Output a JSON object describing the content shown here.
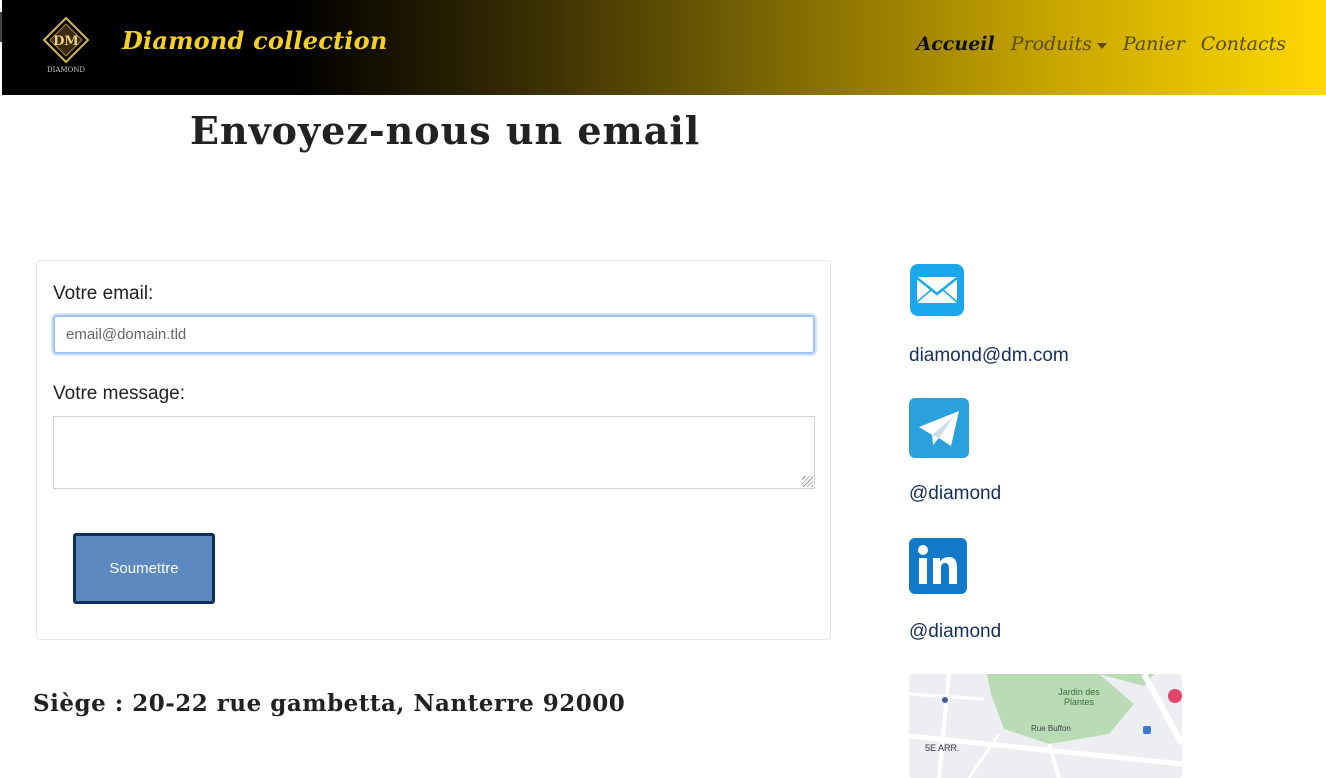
{
  "nav": {
    "brand": "Diamond collection",
    "logo_text": "DIAMOND",
    "links": [
      {
        "label": "Accueil",
        "active": true
      },
      {
        "label": "Produits",
        "dropdown": true
      },
      {
        "label": "Panier"
      },
      {
        "label": "Contacts"
      }
    ]
  },
  "page": {
    "title": "Envoyez-nous un email",
    "address": "Siège : 20-22 rue gambetta, Nanterre 92000"
  },
  "form": {
    "email_label": "Votre email:",
    "email_placeholder": "email@domain.tld",
    "message_label": "Votre message:",
    "submit_label": "Soumettre"
  },
  "contacts": {
    "email": {
      "icon": "envelope-icon",
      "text": "diamond@dm.com",
      "color": "#1da1e6"
    },
    "telegram": {
      "icon": "telegram-icon",
      "text": "@diamond",
      "color": "#2ca5e0"
    },
    "linkedin": {
      "icon": "linkedin-icon",
      "text": "@diamond",
      "color": "#0a66c2"
    }
  },
  "map": {
    "labels": [
      "Jardin des Plantes",
      "Rue Buffon",
      "5E ARR."
    ]
  },
  "colors": {
    "brand_gold": "#f5d128",
    "submit_bg": "#5b89c0",
    "submit_border": "#0e2d5e"
  }
}
